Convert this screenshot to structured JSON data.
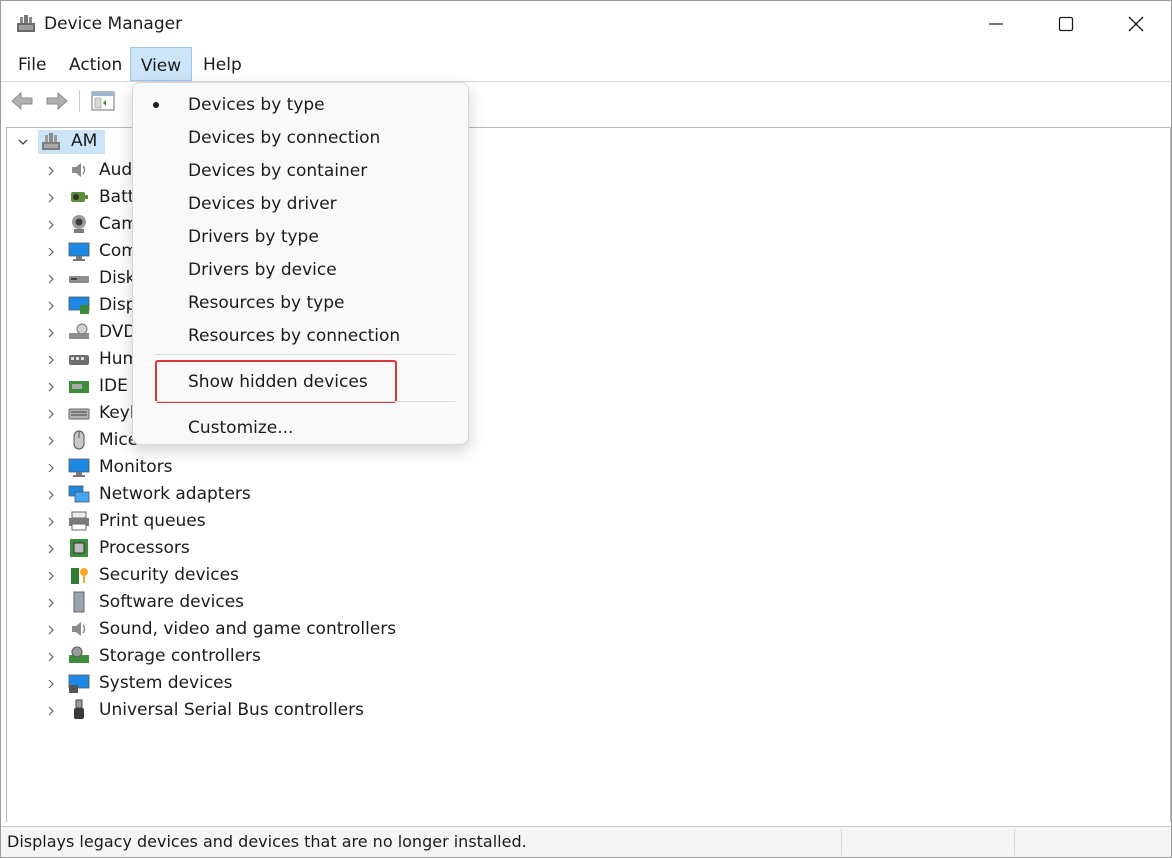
{
  "window": {
    "title": "Device Manager"
  },
  "menubar": {
    "file": "File",
    "action": "Action",
    "view": "View",
    "help": "Help"
  },
  "view_menu": {
    "items": [
      {
        "label": "Devices by type",
        "checked": true
      },
      {
        "label": "Devices by connection"
      },
      {
        "label": "Devices by container"
      },
      {
        "label": "Devices by driver"
      },
      {
        "label": "Drivers by type"
      },
      {
        "label": "Drivers by device"
      },
      {
        "label": "Resources by type"
      },
      {
        "label": "Resources by connection"
      }
    ],
    "show_hidden": "Show hidden devices",
    "customize": "Customize..."
  },
  "tree": {
    "root": "AM",
    "partial_labels": [
      "Aud",
      "Batt",
      "Cam",
      "Com",
      "Disk",
      "Disp",
      "DVD",
      "Hum",
      "IDE A",
      "Keyb",
      "Mice"
    ],
    "items": [
      "Monitors",
      "Network adapters",
      "Print queues",
      "Processors",
      "Security devices",
      "Software devices",
      "Sound, video and game controllers",
      "Storage controllers",
      "System devices",
      "Universal Serial Bus controllers"
    ]
  },
  "status": {
    "text": "Displays legacy devices and devices that are no longer installed."
  },
  "colors": {
    "highlight_border": "#d9383a",
    "selection": "#cce4f7"
  }
}
